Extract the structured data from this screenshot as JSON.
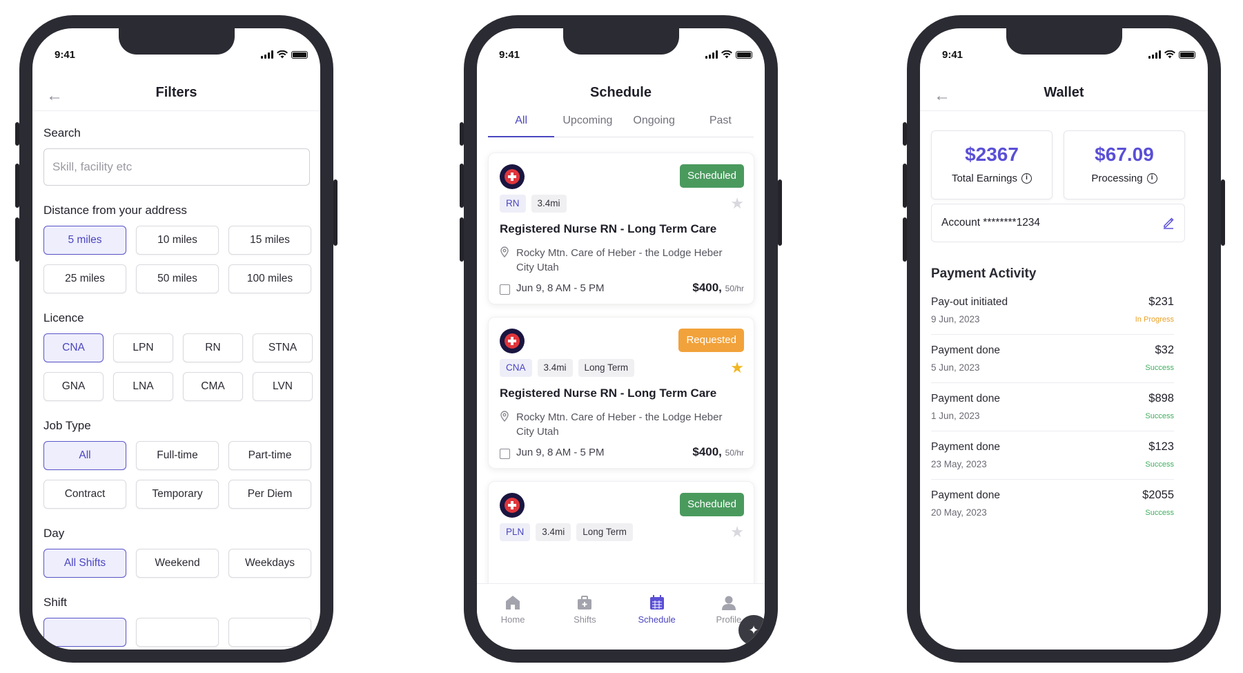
{
  "status_bar": {
    "time": "9:41"
  },
  "filters": {
    "title": "Filters",
    "search": {
      "label": "Search",
      "placeholder": "Skill, facility etc"
    },
    "distance": {
      "label": "Distance from your address",
      "options": [
        "5 miles",
        "10 miles",
        "15 miles",
        "25 miles",
        "50 miles",
        "100 miles"
      ],
      "selected": "5 miles"
    },
    "licence": {
      "label": "Licence",
      "options": [
        "CNA",
        "LPN",
        "RN",
        "STNA",
        "GNA",
        "LNA",
        "CMA",
        "LVN"
      ],
      "selected": "CNA"
    },
    "job_type": {
      "label": "Job Type",
      "options": [
        "All",
        "Full-time",
        "Part-time",
        "Contract",
        "Temporary",
        "Per Diem"
      ],
      "selected": "All"
    },
    "day": {
      "label": "Day",
      "options": [
        "All Shifts",
        "Weekend",
        "Weekdays"
      ],
      "selected": "All Shifts"
    },
    "shift": {
      "label": "Shift"
    }
  },
  "schedule": {
    "title": "Schedule",
    "tabs": [
      "All",
      "Upcoming",
      "Ongoing",
      "Past"
    ],
    "active_tab": "All",
    "cards": [
      {
        "status": "Scheduled",
        "status_color": "#4a9a5e",
        "licence": "RN",
        "distance": "3.4mi",
        "term": "",
        "starred": false,
        "title": "Registered Nurse RN - Long Term Care",
        "location": "Rocky Mtn. Care of Heber - the Lodge Heber City Utah",
        "time": "Jun 9, 8 AM - 5 PM",
        "price": "$400,",
        "rate_unit": "50/hr"
      },
      {
        "status": "Requested",
        "status_color": "#f2a23a",
        "licence": "CNA",
        "distance": "3.4mi",
        "term": "Long Term",
        "starred": true,
        "title": "Registered Nurse RN - Long Term Care",
        "location": "Rocky Mtn. Care of Heber - the Lodge Heber City Utah",
        "time": "Jun 9, 8 AM - 5 PM",
        "price": "$400,",
        "rate_unit": "50/hr"
      },
      {
        "status": "Scheduled",
        "status_color": "#4a9a5e",
        "licence": "PLN",
        "distance": "3.4mi",
        "term": "Long Term",
        "starred": false
      }
    ],
    "nav": [
      {
        "label": "Home",
        "icon": "home-icon"
      },
      {
        "label": "Shifts",
        "icon": "briefcase-icon"
      },
      {
        "label": "Schedule",
        "icon": "calendar-icon"
      },
      {
        "label": "Profile",
        "icon": "profile-icon"
      }
    ],
    "active_nav": "Schedule"
  },
  "wallet": {
    "title": "Wallet",
    "total_earnings": {
      "amount": "$2367",
      "label": "Total Earnings"
    },
    "processing": {
      "amount": "$67.09",
      "label": "Processing"
    },
    "account": "Account ********1234",
    "activity_title": "Payment Activity",
    "activity": [
      {
        "name": "Pay-out initiated",
        "date": "9 Jun, 2023",
        "amount": "$231",
        "status": "In Progress"
      },
      {
        "name": "Payment done",
        "date": "5 Jun, 2023",
        "amount": "$32",
        "status": "Success"
      },
      {
        "name": "Payment done",
        "date": "1 Jun, 2023",
        "amount": "$898",
        "status": "Success"
      },
      {
        "name": "Payment done",
        "date": "23 May, 2023",
        "amount": "$123",
        "status": "Success"
      },
      {
        "name": "Payment done",
        "date": "20 May, 2023",
        "amount": "$2055",
        "status": "Success"
      }
    ]
  },
  "colors": {
    "accent": "#4b45c0",
    "amount": "#5a4fd6",
    "scheduled": "#4a9a5e",
    "requested": "#f2a23a",
    "star_on": "#f0b722",
    "in_progress": "#e9a127",
    "success": "#3fae5e"
  }
}
